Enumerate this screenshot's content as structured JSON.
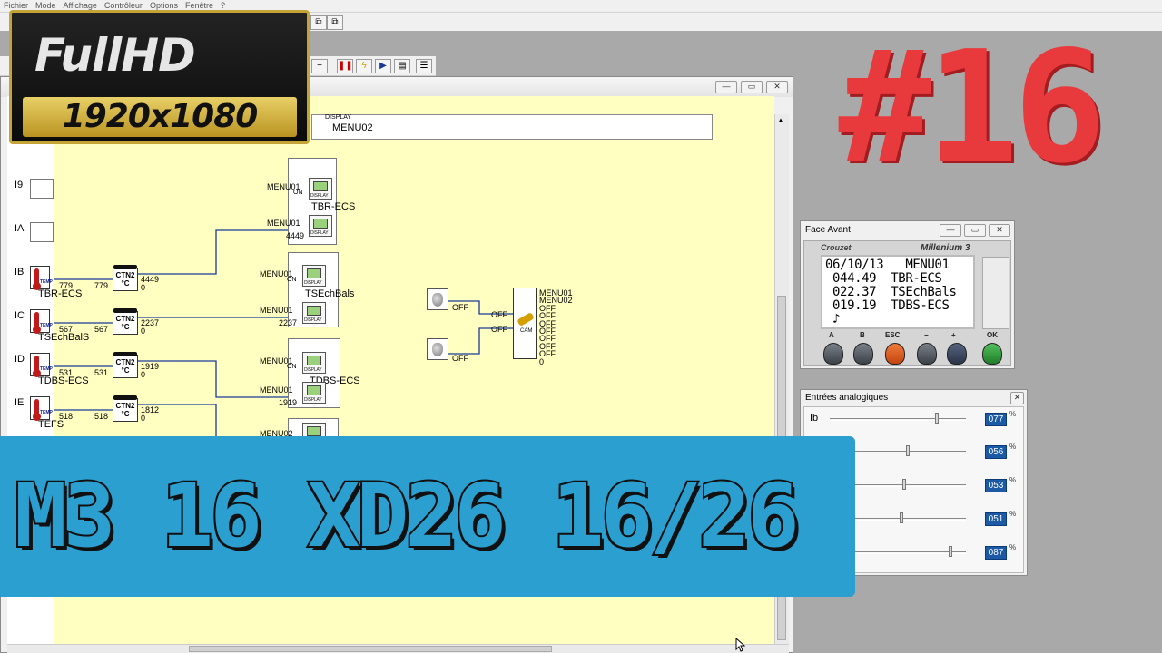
{
  "app": {
    "menu": [
      "Fichier",
      "Mode",
      "Affichage",
      "Contrôleur",
      "Options",
      "Fenêtre",
      "?"
    ]
  },
  "program": {
    "menu02_top": "MENU02",
    "inputs": [
      {
        "label": "I9"
      },
      {
        "label": "IA"
      },
      {
        "label": "IB",
        "name": "TBR-ECS",
        "raw": "779",
        "ctn_out": "779",
        "ctn_val": "4449"
      },
      {
        "label": "IC",
        "name": "TSEchBalS",
        "raw": "567",
        "ctn_out": "567",
        "ctn_val": "2237"
      },
      {
        "label": "ID",
        "name": "TDBS-ECS",
        "raw": "531",
        "ctn_out": "531",
        "ctn_val": "1919"
      },
      {
        "label": "IE",
        "name": "TEFS",
        "raw": "518",
        "ctn_out": "518",
        "ctn_val": "1812"
      }
    ],
    "ctn_label": "CTN2",
    "ctn_unit": "°C",
    "zero": "0",
    "display_text": "DISPLAY",
    "disp_groups": [
      {
        "menu_a": "MENU01",
        "menu_b": "MENU01",
        "on": "ON",
        "value": "4449",
        "name": "TBR-ECS"
      },
      {
        "menu_a": "MENU01",
        "menu_b": "MENU01",
        "on": "ON",
        "value": "2237",
        "name": "TSEchBals"
      },
      {
        "menu_a": "MENU01",
        "menu_b": "MENU01",
        "on": "ON",
        "value": "1919",
        "name": "TDBS-ECS"
      },
      {
        "menu_a": "MENU02"
      }
    ],
    "off": "OFF",
    "cam": {
      "label": "CAM",
      "outputs": [
        "MENU01",
        "MENU02",
        "OFF",
        "OFF",
        "OFF",
        "OFF",
        "OFF",
        "OFF",
        "OFF",
        "0"
      ]
    }
  },
  "face_avant": {
    "title": "Face Avant",
    "brand": "Crouzet",
    "model": "Millenium 3",
    "lcd_lines": [
      "06/10/13   MENU01",
      " 044.49  TBR-ECS",
      " 022.37  TSEchBals",
      " 019.19  TDBS-ECS",
      " ♪"
    ],
    "keys": [
      "A",
      "B",
      "ESC",
      "−",
      "+",
      "OK"
    ],
    "key_colors": [
      "#5a6068",
      "#5a6068",
      "#e35b1c",
      "#5a6068",
      "#3a4a66",
      "#2f9b3a"
    ]
  },
  "entrees": {
    "title": "Entrées analogiques",
    "rows": [
      {
        "label": "Ib",
        "value": "077",
        "level": 0.77
      },
      {
        "label": "",
        "value": "056",
        "level": 0.56
      },
      {
        "label": "",
        "value": "053",
        "level": 0.53
      },
      {
        "label": "",
        "value": "051",
        "level": 0.51
      },
      {
        "label": "",
        "value": "087",
        "level": 0.87
      }
    ],
    "unit": "%"
  },
  "overlays": {
    "fullhd_top": "FullHD",
    "fullhd_res": "1920x1080",
    "episode": "#16",
    "banner": "M3 16 XD26 16/26"
  }
}
